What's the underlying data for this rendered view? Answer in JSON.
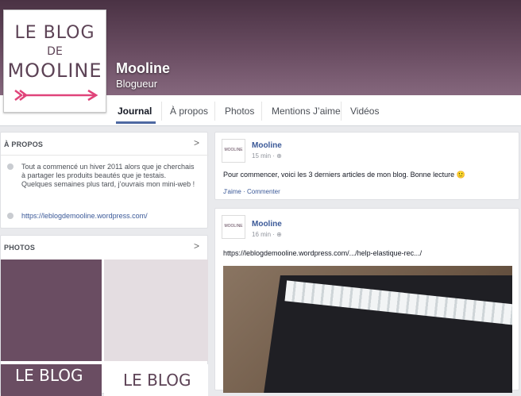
{
  "page": {
    "name": "Mooline",
    "category": "Blogueur"
  },
  "logo": {
    "line1": "LE BLOG",
    "line2": "DE",
    "line3": "MOOLINE",
    "arrow_color": "#e0447a"
  },
  "tabs": [
    {
      "label": "Journal",
      "active": true
    },
    {
      "label": "À propos"
    },
    {
      "label": "Photos"
    },
    {
      "label": "Mentions J’aime"
    },
    {
      "label": "Vidéos"
    }
  ],
  "about": {
    "header": "À PROPOS",
    "description": "Tout a commencé un hiver 2011 alors que je cherchais à partager les produits beautés que je testais. Quelques semaines plus tard, j’ouvrais mon mini-web !",
    "website": "https://leblogdemooline.wordpress.com/"
  },
  "photos": {
    "header": "PHOTOS"
  },
  "posts": [
    {
      "author": "Mooline",
      "time": "15 min",
      "text": "Pour commencer, voici les 3 derniers articles de mon blog. Bonne lecture 🙂",
      "actions": "J'aime · Commenter"
    },
    {
      "author": "Mooline",
      "time": "16 min",
      "link": "https://leblogdemooline.wordpress.com/.../help-elastique-rec.../"
    }
  ],
  "colors": {
    "cover": "#5a3f54",
    "link": "#3b5998",
    "tab_underline": "#4e69a2"
  }
}
